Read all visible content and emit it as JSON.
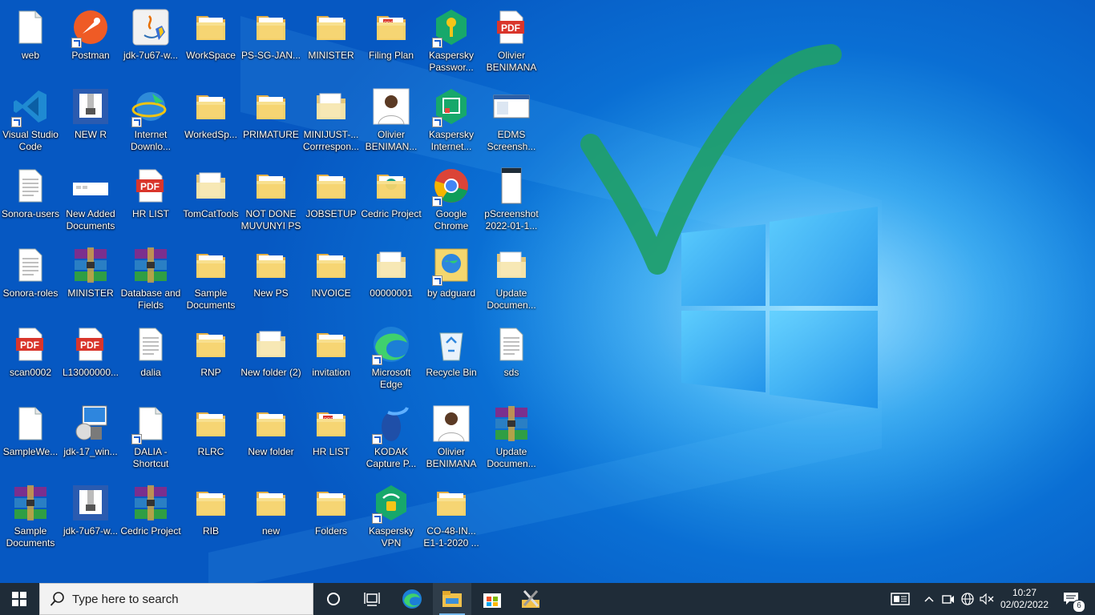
{
  "desktop": {
    "icons": [
      {
        "label": "web",
        "type": "doc"
      },
      {
        "label": "Postman",
        "type": "postman",
        "shortcut": true
      },
      {
        "label": "jdk-7u67-w...",
        "type": "java"
      },
      {
        "label": "WorkSpace",
        "type": "folder"
      },
      {
        "label": "PS-SG-JAN...",
        "type": "folder"
      },
      {
        "label": "MINISTER",
        "type": "folder"
      },
      {
        "label": "Filing Plan",
        "type": "folder-pdf"
      },
      {
        "label": "Kaspersky Passwor...",
        "type": "kaspersky-pw",
        "shortcut": true
      },
      {
        "label": "Olivier BENIMANA",
        "type": "pdf"
      },
      {
        "label": "Visual Studio Code",
        "type": "vscode",
        "shortcut": true
      },
      {
        "label": "NEW R",
        "type": "zip-blue"
      },
      {
        "label": "Internet Downlo...",
        "type": "idm",
        "shortcut": true
      },
      {
        "label": "WorkedSp...",
        "type": "folder"
      },
      {
        "label": "PRIMATURE",
        "type": "folder"
      },
      {
        "label": "MINIJUST-... Corrrespon...",
        "type": "folder-light"
      },
      {
        "label": "Olivier BENIMAN...",
        "type": "photo"
      },
      {
        "label": "Kaspersky Internet...",
        "type": "kaspersky-is",
        "shortcut": true
      },
      {
        "label": "EDMS Screensh...",
        "type": "screenshot"
      },
      {
        "label": "Sonora-users",
        "type": "doc-lines"
      },
      {
        "label": "New Added Documents",
        "type": "white-bar"
      },
      {
        "label": "HR LIST",
        "type": "pdf"
      },
      {
        "label": "TomCatTools",
        "type": "folder-light"
      },
      {
        "label": "NOT DONE MUVUNYI PS",
        "type": "folder"
      },
      {
        "label": "JOBSETUP",
        "type": "folder"
      },
      {
        "label": "Cedric Project",
        "type": "folder-green"
      },
      {
        "label": "Google Chrome",
        "type": "chrome",
        "shortcut": true
      },
      {
        "label": "pScreenshot 2022-01-1...",
        "type": "phone-shot"
      },
      {
        "label": "Sonora-roles",
        "type": "doc-lines"
      },
      {
        "label": "MINISTER",
        "type": "rar"
      },
      {
        "label": "Database and Fields",
        "type": "rar"
      },
      {
        "label": "Sample Documents",
        "type": "folder"
      },
      {
        "label": "New PS",
        "type": "folder"
      },
      {
        "label": "INVOICE",
        "type": "folder"
      },
      {
        "label": "00000001",
        "type": "folder-light"
      },
      {
        "label": "by adguard",
        "type": "globe-cert",
        "shortcut": true
      },
      {
        "label": "Update Documen...",
        "type": "folder-light"
      },
      {
        "label": "scan0002",
        "type": "pdf"
      },
      {
        "label": "L13000000...",
        "type": "pdf"
      },
      {
        "label": "dalia",
        "type": "doc-lines"
      },
      {
        "label": "RNP",
        "type": "folder"
      },
      {
        "label": "New folder (2)",
        "type": "folder-light"
      },
      {
        "label": "invitation",
        "type": "folder"
      },
      {
        "label": "Microsoft Edge",
        "type": "edge",
        "shortcut": true
      },
      {
        "label": "Recycle Bin",
        "type": "recycle"
      },
      {
        "label": "sds",
        "type": "doc-lines"
      },
      {
        "label": "SampleWe...",
        "type": "doc"
      },
      {
        "label": "jdk-17_win...",
        "type": "installer"
      },
      {
        "label": "DALIA - Shortcut",
        "type": "doc",
        "shortcut": true
      },
      {
        "label": "RLRC",
        "type": "folder"
      },
      {
        "label": "New folder",
        "type": "folder"
      },
      {
        "label": "HR LIST",
        "type": "folder-pdf"
      },
      {
        "label": "KODAK Capture P...",
        "type": "kodak",
        "shortcut": true
      },
      {
        "label": "Olivier BENIMANA",
        "type": "photo"
      },
      {
        "label": "Update Documen...",
        "type": "rar"
      },
      {
        "label": "Sample Documents",
        "type": "rar"
      },
      {
        "label": "jdk-7u67-w...",
        "type": "zip-blue"
      },
      {
        "label": "Cedric Project",
        "type": "rar"
      },
      {
        "label": "RIB",
        "type": "folder"
      },
      {
        "label": "new",
        "type": "folder"
      },
      {
        "label": "Folders",
        "type": "folder"
      },
      {
        "label": "Kaspersky VPN",
        "type": "kaspersky-vpn",
        "shortcut": true
      },
      {
        "label": "CO-48-IN... E1-1-2020 ...",
        "type": "folder"
      }
    ]
  },
  "taskbar": {
    "search_placeholder": "Type here to search",
    "clock_time": "10:27",
    "clock_date": "02/02/2022",
    "notification_count": "6",
    "icons": [
      "windows-start-icon",
      "search-icon",
      "cortana-icon",
      "task-view-icon",
      "edge-icon",
      "file-explorer-icon",
      "microsoft-store-icon",
      "tool-icon",
      "news-icon",
      "chevron-up-icon",
      "meet-now-icon",
      "network-icon",
      "volume-muted-icon",
      "notifications-icon"
    ]
  },
  "colors": {
    "desktop_bg": "#0a6fd4",
    "taskbar_bg": "#1f2c38",
    "checkmark": "#1f9e6a",
    "folder": "#f5d36b"
  }
}
